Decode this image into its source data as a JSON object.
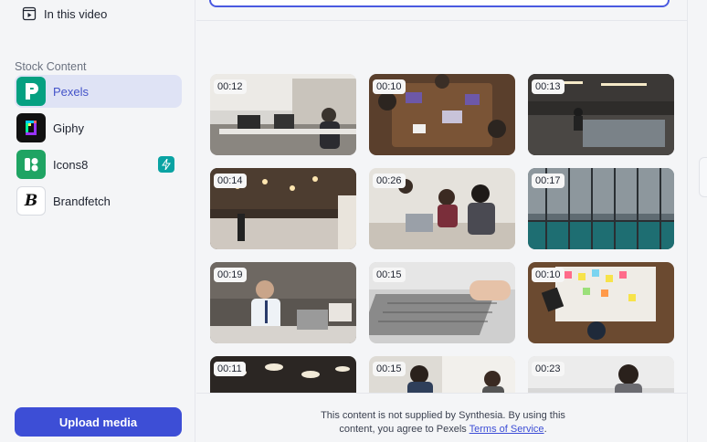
{
  "sidebar": {
    "video_item": {
      "label": "In this video",
      "icon": "video-frame-icon"
    },
    "section_label": "Stock Content",
    "sources": [
      {
        "label": "Pexels",
        "icon": "pexels-logo-icon",
        "active": true
      },
      {
        "label": "Giphy",
        "icon": "giphy-logo-icon",
        "active": false
      },
      {
        "label": "Icons8",
        "icon": "icons8-logo-icon",
        "active": false,
        "badge_icon": "lightning-bolt-icon"
      },
      {
        "label": "Brandfetch",
        "icon": "brandfetch-logo-icon",
        "active": false
      }
    ],
    "upload_label": "Upload media"
  },
  "grid": {
    "tiles": [
      {
        "duration": "00:12",
        "scene": "office-workers"
      },
      {
        "duration": "00:10",
        "scene": "meeting-table-top"
      },
      {
        "duration": "00:13",
        "scene": "open-office"
      },
      {
        "duration": "00:14",
        "scene": "office-lights"
      },
      {
        "duration": "00:26",
        "scene": "team-discussion"
      },
      {
        "duration": "00:17",
        "scene": "glass-building"
      },
      {
        "duration": "00:19",
        "scene": "man-laptop"
      },
      {
        "duration": "00:15",
        "scene": "typing-laptop"
      },
      {
        "duration": "00:10",
        "scene": "sticky-notes"
      },
      {
        "duration": "00:11",
        "scene": "ceiling-lamps"
      },
      {
        "duration": "00:15",
        "scene": "coworkers"
      },
      {
        "duration": "00:23",
        "scene": "woman-desk"
      }
    ]
  },
  "footer": {
    "text_before": "This content is not supplied by Synthesia. By using this content, you agree to Pexels ",
    "link": "Terms of Service",
    "text_after": "."
  },
  "colors": {
    "accent": "#3d4ed6",
    "active_bg": "#dfe3f5",
    "pexels": "#05a081",
    "icons8": "#1fa463",
    "bolt_badge": "#0aa3a3"
  }
}
